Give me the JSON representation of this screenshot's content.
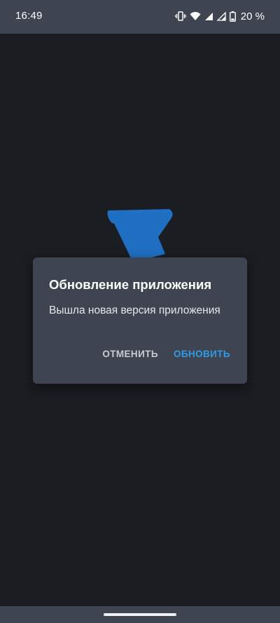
{
  "status_bar": {
    "time": "16:49",
    "battery_percent": "20 %",
    "icons": [
      "vibrate-icon",
      "wifi-icon",
      "cell-signal-icon",
      "cell-signal-icon",
      "battery-icon"
    ]
  },
  "splash": {
    "logo_icon": "app-logo-icon",
    "logo_color": "#1f6fc2"
  },
  "dialog": {
    "title": "Обновление приложения",
    "message": "Вышла новая версия приложения",
    "cancel_label": "ОТМЕНИТЬ",
    "update_label": "ОБНОВИТЬ",
    "accent_color": "#2f9be6"
  },
  "nav_bar": {
    "handle": "gesture-handle"
  }
}
